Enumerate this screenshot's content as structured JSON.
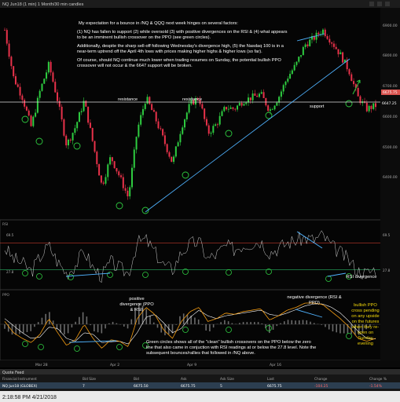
{
  "window": {
    "symbol_line": "NQ Jun18 (1 min) 1 Month/30 min candles",
    "bottom_bar_time": "2:18:58 PM 4/21/2018"
  },
  "quote": {
    "title": "Quote Feed",
    "headers": [
      "Financial Instrument",
      "Bid Size",
      "Bid",
      "Ask",
      "Ask Size",
      "Last",
      "Change",
      "Change %"
    ],
    "row": [
      "NQ Jun18 (GLOBEX)",
      "7",
      "6675.50",
      "6675.75",
      "5",
      "6675.75",
      "-104.25",
      "-1.54%"
    ]
  },
  "annotations": {
    "para1": "My expectation for a bounce in /NQ & QQQ next week hinges on several factors:",
    "para2": "(1) NQ has fallen to support (2) while oversold (3) with positive divergences on the RSI & (4) what appears to be an imminent bullish crossover on the PPO (see green circles).",
    "para3": "Additionally, despite the sharp sell-off following Wednesday's divergence high, (5) the Nasdaq 100 is in a near-term uptrend off the April 4th lows with prices making higher highs & higher lows (so far).",
    "para4": "Of course, should NQ continue much lower when trading resumes on Sunday, the potential bullish PPO crossover will not occur & the 6647 support will be broken.",
    "resistance1": "resistance",
    "resistance2": "resistance",
    "support": "support",
    "rsi_div": "RSI divergence",
    "pos_div": "positive divergence (PPO & RSI)",
    "neg_div": "negative divergence (RSI & PPO)",
    "ppo_note": "Green circles shows all of the \"clean\" bullish crossovers on the PPO below the zero line that also came in conjuction with RSI readings at or below the 27.8 level. Note the subsequent bounces/rallies that followed in /NQ above.",
    "bullish_ppo": "bullish PPO cross pending on any upside on the futures when they re-open on Sunday evening"
  },
  "chart_data": [
    {
      "type": "candlestick",
      "y_ticks": [
        "6900.00",
        "6800.00",
        "6700.00",
        "6600.00",
        "6500.00",
        "6400.00"
      ],
      "ylim": [
        6340,
        6960
      ],
      "support_level": "6647.25",
      "last_price_tag": "6675.75",
      "x_ticks": [
        "Mar 28",
        "Apr 2",
        "Apr 9",
        "Apr 16"
      ],
      "close_path": [
        6905,
        6760,
        6700,
        6610,
        6720,
        6800,
        6690,
        6555,
        6610,
        6690,
        6560,
        6430,
        6520,
        6460,
        6395,
        6600,
        6700,
        6640,
        6570,
        6500,
        6610,
        6680,
        6700,
        6590,
        6620,
        6670,
        6665,
        6690,
        6700,
        6710,
        6660,
        6700,
        6760,
        6800,
        6860,
        6880,
        6905,
        6870,
        6830,
        6780,
        6700,
        6665,
        6675
      ]
    },
    {
      "type": "line",
      "name": "RSI",
      "levels": [
        "69.5",
        "27.8"
      ],
      "ylim": [
        0,
        100
      ],
      "values": [
        62,
        45,
        38,
        25,
        48,
        66,
        40,
        22,
        35,
        58,
        30,
        18,
        40,
        30,
        22,
        70,
        75,
        55,
        35,
        28,
        55,
        68,
        72,
        45,
        52,
        65,
        60,
        67,
        70,
        73,
        55,
        62,
        70,
        74,
        78,
        75,
        82,
        65,
        55,
        42,
        26,
        22,
        30
      ]
    },
    {
      "type": "line",
      "name": "PPO",
      "ylim": [
        -1,
        1
      ],
      "ppo": [
        0.1,
        -0.3,
        -0.5,
        -0.65,
        -0.35,
        0.2,
        -0.3,
        -0.75,
        -0.55,
        0.0,
        -0.5,
        -0.85,
        -0.55,
        -0.6,
        -0.8,
        0.2,
        0.6,
        0.35,
        -0.2,
        -0.5,
        0.1,
        0.45,
        0.6,
        0.1,
        0.2,
        0.4,
        0.35,
        0.45,
        0.5,
        0.55,
        0.15,
        0.3,
        0.5,
        0.6,
        0.75,
        0.75,
        0.7,
        0.45,
        0.2,
        -0.1,
        -0.5,
        -0.6,
        -0.5
      ],
      "signal": [
        0.2,
        -0.05,
        -0.3,
        -0.5,
        -0.45,
        -0.1,
        -0.15,
        -0.5,
        -0.6,
        -0.3,
        -0.35,
        -0.65,
        -0.62,
        -0.6,
        -0.7,
        -0.3,
        0.25,
        0.35,
        0.05,
        -0.3,
        -0.15,
        0.25,
        0.5,
        0.3,
        0.2,
        0.3,
        0.35,
        0.4,
        0.45,
        0.5,
        0.35,
        0.3,
        0.4,
        0.52,
        0.65,
        0.72,
        0.72,
        0.6,
        0.4,
        0.1,
        -0.25,
        -0.5,
        -0.52
      ]
    }
  ]
}
